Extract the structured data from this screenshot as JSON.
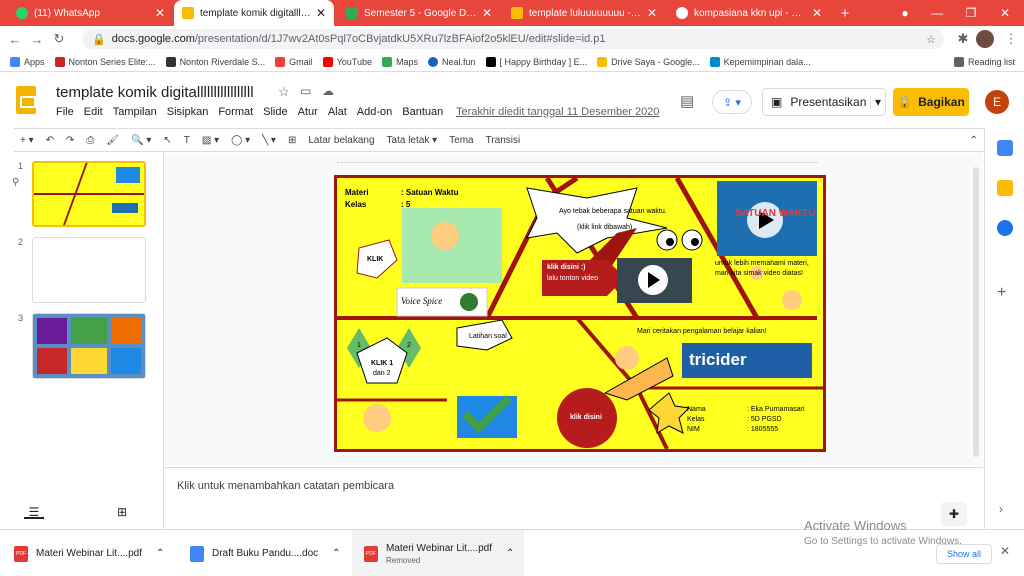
{
  "tabs": [
    {
      "title": "(11) WhatsApp",
      "color": "#25d366"
    },
    {
      "title": "template komik digitalllllllllllllllll",
      "color": "#fbbc04"
    },
    {
      "title": "Semester 5 - Google Drive",
      "color": "#34a853"
    },
    {
      "title": "template luluuuuuuuu - Goo",
      "color": "#fbbc04"
    },
    {
      "title": "kompasiana kkn upi - Penelu",
      "color": "#4285f4"
    }
  ],
  "url": {
    "host": "docs.google.com",
    "path": "/presentation/d/1J7wv2At0sPql7oCBvjatdkU5XRu7lzBFAiof2o5klEU/edit#slide=id.p1"
  },
  "bookmarks": [
    "Apps",
    "Nonton Series Elite:...",
    "Nonton Riverdale S...",
    "Gmail",
    "YouTube",
    "Maps",
    "Neal.fun",
    "[ Happy Birthday ] E...",
    "Drive Saya - Google...",
    "Kepemimpinan dala..."
  ],
  "reading_list": "Reading list",
  "doc": {
    "title": "template komik digitalllllllllllllllll",
    "last_edit": "Terakhir diedit tanggal 11 Desember 2020",
    "present": "Presentasikan",
    "share": "Bagikan",
    "avatar": "E"
  },
  "menus": [
    "File",
    "Edit",
    "Tampilan",
    "Sisipkan",
    "Format",
    "Slide",
    "Atur",
    "Alat",
    "Add-on",
    "Bantuan"
  ],
  "toolbar": {
    "background": "Latar belakang",
    "layout": "Tata letak",
    "theme": "Tema",
    "transition": "Transisi"
  },
  "slides": [
    "1",
    "2",
    "3"
  ],
  "notes_placeholder": "Klik untuk menambahkan catatan pembicara",
  "slide": {
    "materi_label": "Materi",
    "materi_value": ": Satuan Waktu",
    "kelas_label": "Kelas",
    "kelas_value": ":  5",
    "bubble_top": "Ayo tebak beberapa satuan waktu.",
    "bubble_top2": "(klik link dibawah)",
    "klik": "KLIK",
    "voice": "Voice Spice",
    "klik_disini": "klik disini :)",
    "klik_disini2": "lalu tonton video",
    "video_note": "untuk lebih memahami materi,",
    "video_note2": "mari kita simak video diatas!",
    "video_title": "SATUAN WAKTU",
    "latihan": "Latihan soal",
    "cerita": "Mari ceritakan pengalaman belajar kalian!",
    "tricider": "tricider",
    "num1": "1",
    "num2": "2",
    "klik12": "KLIK 1",
    "klik12b": "dan 2",
    "klik_disini_red": "klik disini",
    "nama_label": "Nama",
    "nama_value": ": Eka Purnamasari",
    "kelas2_label": "Kelas",
    "kelas2_value": ": 5D PGSD",
    "nim_label": "NIM",
    "nim_value": ": 1805555"
  },
  "downloads": [
    {
      "name": "Materi Webinar Lit....pdf",
      "type": "pdf",
      "status": ""
    },
    {
      "name": "Draft Buku Pandu....doc",
      "type": "doc",
      "status": ""
    },
    {
      "name": "Materi Webinar Lit....pdf",
      "type": "pdf",
      "status": "Removed"
    }
  ],
  "show_all": "Show all",
  "activate": {
    "line1": "Activate Windows",
    "line2": "Go to Settings to activate Windows."
  }
}
